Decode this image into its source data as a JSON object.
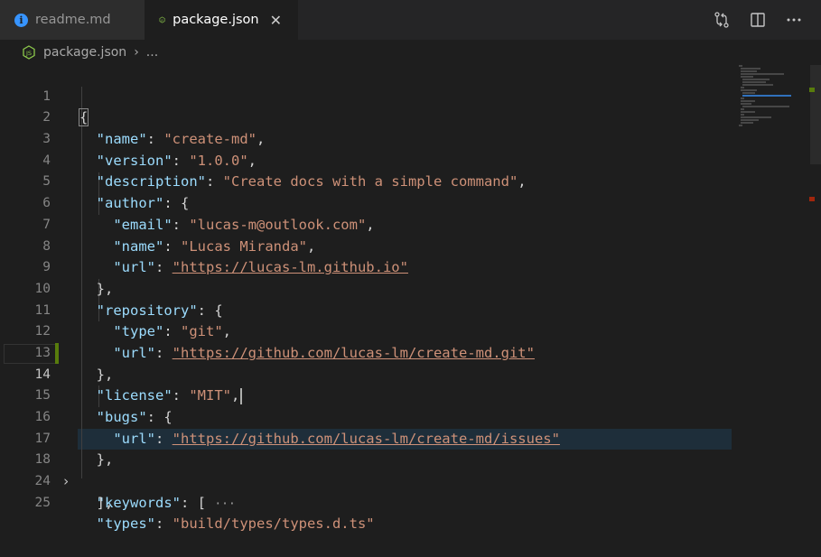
{
  "tabs": [
    {
      "label": "readme.md",
      "icon": "info-icon",
      "active": false
    },
    {
      "label": "package.json",
      "icon": "js-file-icon",
      "active": true,
      "close": "✕"
    }
  ],
  "breadcrumb": {
    "file": "package.json",
    "separator": "›",
    "rest": "..."
  },
  "editor": {
    "current_line": 14,
    "lines": [
      {
        "n": "1"
      },
      {
        "n": "2"
      },
      {
        "n": "3"
      },
      {
        "n": "4"
      },
      {
        "n": "5"
      },
      {
        "n": "6"
      },
      {
        "n": "7"
      },
      {
        "n": "8"
      },
      {
        "n": "9"
      },
      {
        "n": "10"
      },
      {
        "n": "11"
      },
      {
        "n": "12"
      },
      {
        "n": "13"
      },
      {
        "n": "14"
      },
      {
        "n": "15"
      },
      {
        "n": "16"
      },
      {
        "n": "17"
      },
      {
        "n": "18"
      },
      {
        "n": "24"
      },
      {
        "n": "25"
      }
    ],
    "tokens": {
      "l1_brace": "{",
      "l2_key": "\"name\"",
      "l2_val": "\"create-md\"",
      "l3_key": "\"version\"",
      "l3_val": "\"1.0.0\"",
      "l4_key": "\"description\"",
      "l4_val": "\"Create docs with a simple command\"",
      "l5_key": "\"author\"",
      "l5_rest": ": {",
      "l6_key": "\"email\"",
      "l6_val": "\"lucas-m@outlook.com\"",
      "l7_key": "\"name\"",
      "l7_val": "\"Lucas Miranda\"",
      "l8_key": "\"url\"",
      "l8_val": "\"https://lucas-lm.github.io\"",
      "l9_text": "},",
      "l10_key": "\"repository\"",
      "l10_rest": ": {",
      "l11_key": "\"type\"",
      "l11_val": "\"git\"",
      "l12_key": "\"url\"",
      "l12_val": "\"https://github.com/lucas-lm/create-md.git\"",
      "l13_text": "},",
      "l14_key": "\"license\"",
      "l14_val": "\"MIT\"",
      "l15_key": "\"bugs\"",
      "l15_rest": ": {",
      "l16_key": "\"url\"",
      "l16_val": "\"https://github.com/lucas-lm/create-md/issues\"",
      "l17_text": "},",
      "l18_key": "\"keywords\"",
      "l18_rest": ": [",
      "l18_fold": "···",
      "l24_text": "],",
      "l25_key": "\"types\"",
      "l25_val": "\"build/types/types.d.ts\""
    }
  },
  "actions": [
    "compare-changes-icon",
    "split-editor-icon",
    "more-actions-icon"
  ],
  "colors": {
    "key": "#9cdcfe",
    "string": "#ce9178",
    "modified": "#587c0c",
    "accent": "#3794ff"
  }
}
